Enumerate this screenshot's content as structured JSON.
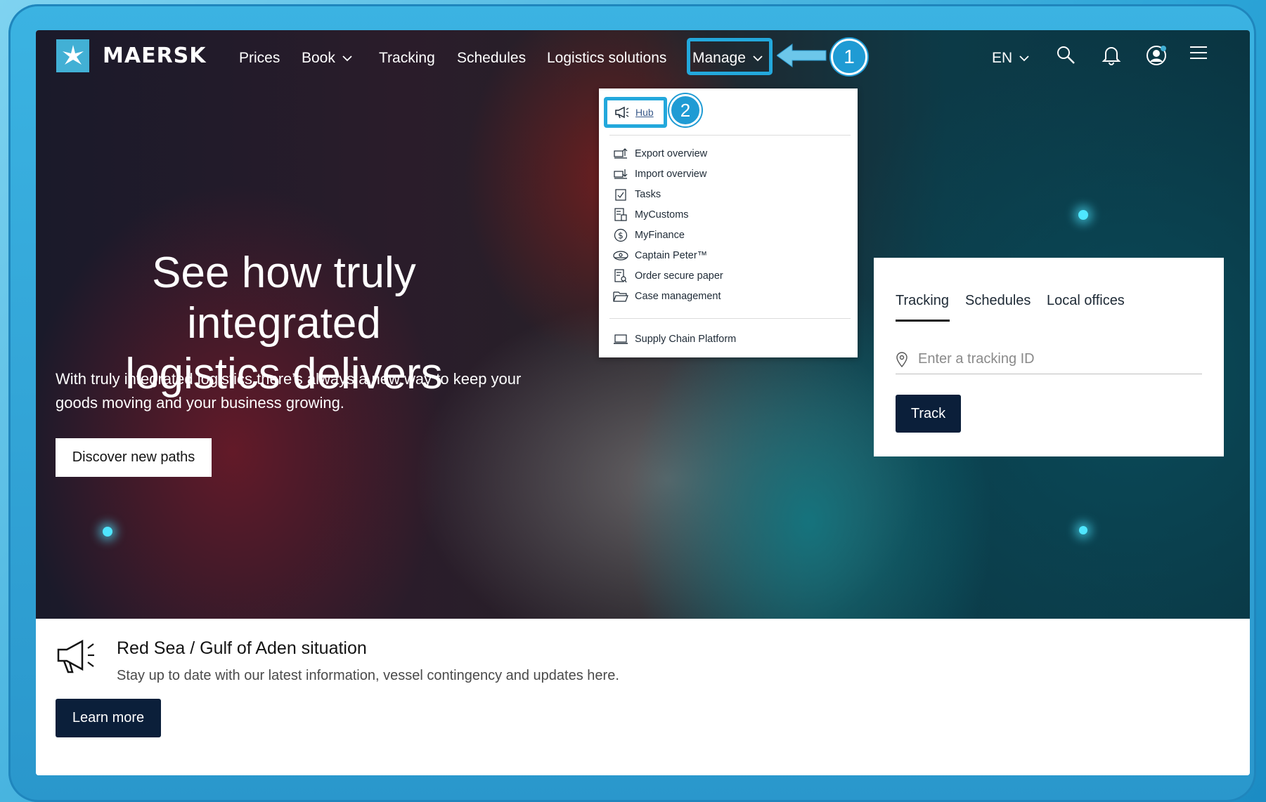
{
  "brand": {
    "name": "MAERSK",
    "accent": "#42b0d5",
    "callout_color": "#23a8dc",
    "dark_button": "#0b1f3a"
  },
  "nav": {
    "items": [
      {
        "label": "Prices"
      },
      {
        "label": "Book"
      },
      {
        "label": "Tracking"
      },
      {
        "label": "Schedules"
      },
      {
        "label": "Logistics solutions"
      },
      {
        "label": "Manage"
      }
    ],
    "language": "EN",
    "icons": [
      "search-icon",
      "bell-icon",
      "user-icon",
      "hamburger-menu-icon"
    ]
  },
  "callouts": {
    "step1": "1",
    "step2": "2"
  },
  "dropdown": {
    "hub_label": "Hub",
    "items": [
      {
        "label": "Export overview",
        "icon": "export-icon"
      },
      {
        "label": "Import overview",
        "icon": "import-icon"
      },
      {
        "label": "Tasks",
        "icon": "checkbox-icon"
      },
      {
        "label": "MyCustoms",
        "icon": "customs-document-icon"
      },
      {
        "label": "MyFinance",
        "icon": "dollar-circle-icon"
      },
      {
        "label": "Captain Peter™",
        "icon": "captain-hat-icon"
      },
      {
        "label": "Order secure paper",
        "icon": "secure-paper-icon"
      },
      {
        "label": "Case management",
        "icon": "folder-icon"
      }
    ],
    "footer_item": {
      "label": "Supply Chain Platform",
      "icon": "laptop-icon"
    }
  },
  "hero": {
    "headline_line1": "See how truly integrated",
    "headline_line2": "logistics delivers",
    "subtext": "With truly integrated logistics there’s always a new way to keep your goods moving and your business growing.",
    "cta": "Discover new paths"
  },
  "tracking_card": {
    "tabs": [
      {
        "label": "Tracking"
      },
      {
        "label": "Schedules"
      },
      {
        "label": "Local offices"
      }
    ],
    "input_placeholder": "Enter a tracking ID",
    "button": "Track"
  },
  "announcement": {
    "title": "Red Sea / Gulf of Aden situation",
    "text": "Stay up to date with our latest information, vessel contingency and updates here.",
    "button": "Learn more"
  }
}
